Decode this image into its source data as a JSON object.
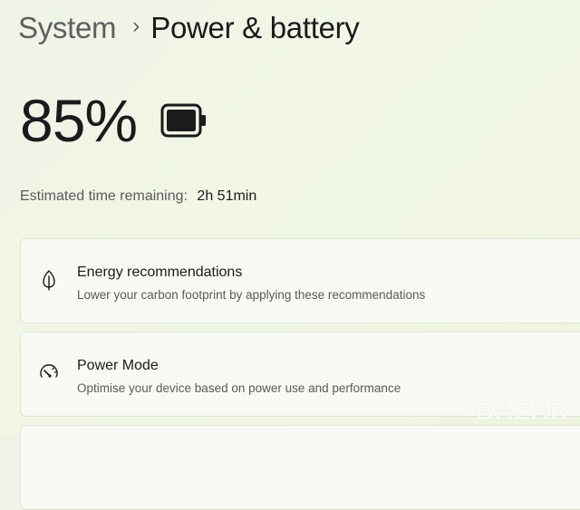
{
  "breadcrumb": {
    "parent": "System",
    "separator": "›",
    "current": "Power & battery"
  },
  "battery": {
    "percent_label": "85%",
    "icon": "battery-icon",
    "charge_level": 0.85
  },
  "time_remaining": {
    "label": "Estimated time remaining:",
    "value": "2h 51min"
  },
  "cards": [
    {
      "icon": "leaf-icon",
      "title": "Energy recommendations",
      "subtitle": "Lower your carbon footprint by applying these recommendations"
    },
    {
      "icon": "gauge-icon",
      "title": "Power Mode",
      "subtitle": "Optimise your device based on power use and performance"
    }
  ],
  "watermark": "BAZAR",
  "colors": {
    "background": "#eef3e6",
    "card_background": "#f8faf3",
    "text_primary": "#1b1b1b",
    "text_secondary": "#5a5a5a"
  }
}
